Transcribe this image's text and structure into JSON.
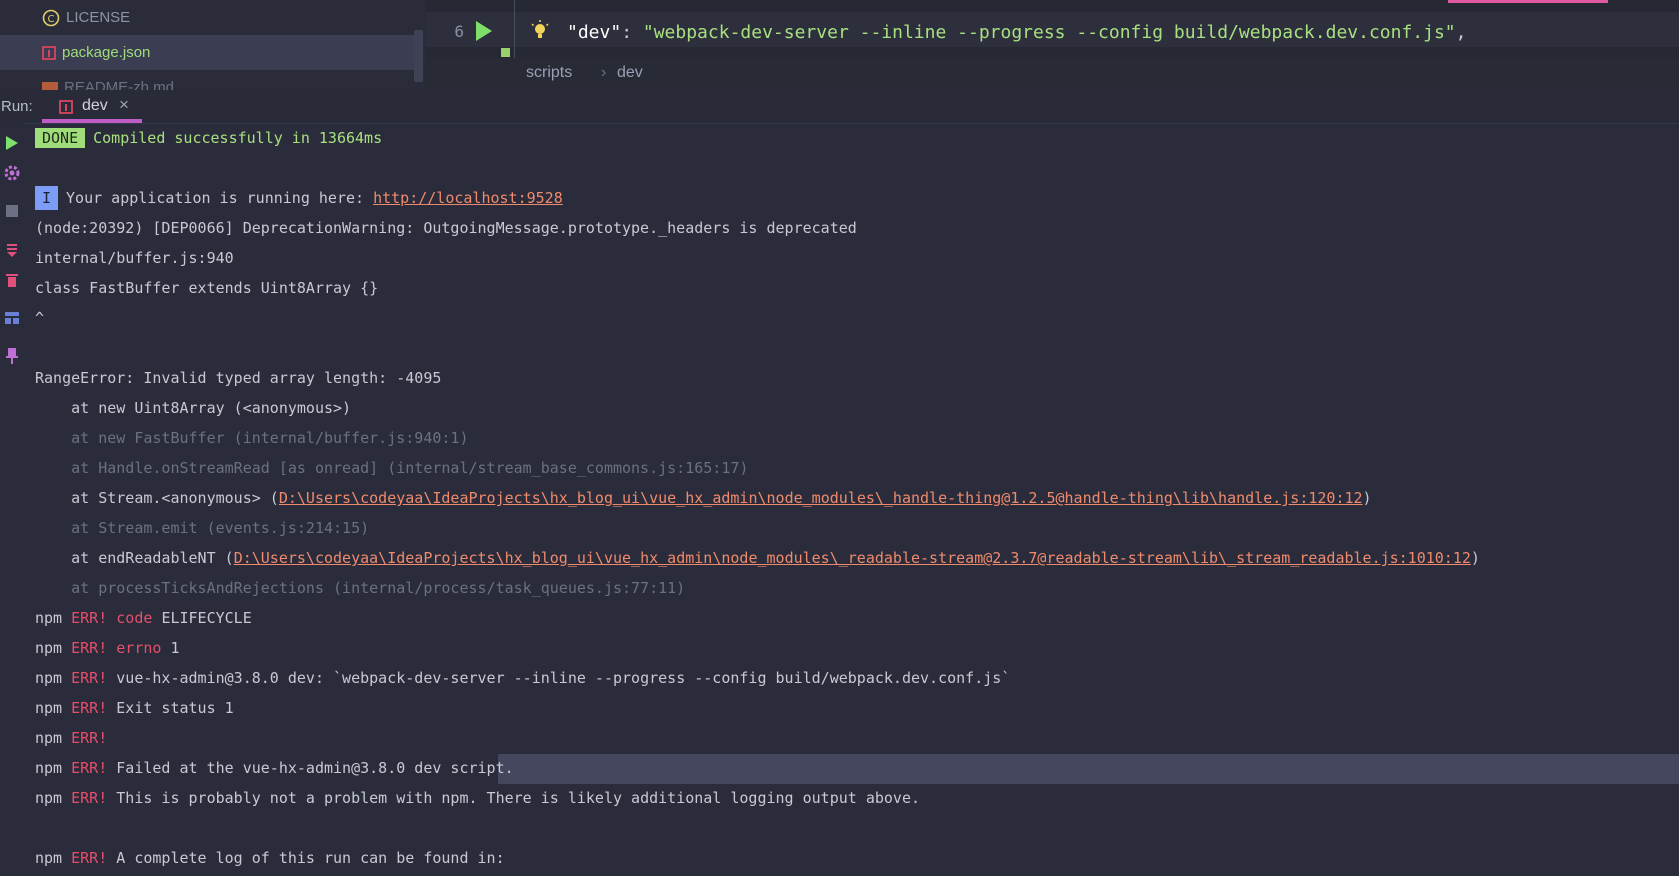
{
  "project": {
    "items": [
      {
        "label": "LICENSE",
        "icon": "license-icon",
        "selected": false
      },
      {
        "label": "package.json",
        "icon": "npm-file-icon",
        "selected": true
      },
      {
        "label": "README-zh.md",
        "icon": "markdown-file-icon",
        "selected": false
      }
    ]
  },
  "editor": {
    "line_number": "6",
    "code_key": "\"dev\"",
    "code_colon": ": ",
    "code_value": "\"webpack-dev-server --inline --progress --config build/webpack.dev.conf.js\"",
    "code_comma": ","
  },
  "breadcrumb": {
    "items": [
      "scripts",
      "dev"
    ],
    "separator": "›"
  },
  "run": {
    "label": "Run:",
    "tab_label": "dev",
    "tab_close": "×"
  },
  "console": {
    "done_badge": "DONE",
    "compiled": "Compiled successfully in 13664ms",
    "info_badge": "I",
    "running_prefix": "Your application is running here: ",
    "running_url": "http://localhost:9528",
    "deprecation": "(node:20392) [DEP0066] DeprecationWarning: OutgoingMessage.prototype._headers is deprecated",
    "buffer": "internal/buffer.js:940",
    "class_line": "class FastBuffer extends Uint8Array {}",
    "caret": "^",
    "range_error": "RangeError: Invalid typed array length: -4095",
    "stack1": "    at new Uint8Array (<anonymous>)",
    "stack2": "    at new FastBuffer (internal/buffer.js:940:1)",
    "stack3": "    at Handle.onStreamRead [as onread] (internal/stream_base_commons.js:165:17)",
    "stack4_prefix": "    at Stream.<anonymous> (",
    "stack4_link": "D:\\Users\\codeyaa\\IdeaProjects\\hx_blog_ui\\vue_hx_admin\\node_modules\\_handle-thing@1.2.5@handle-thing\\lib\\handle.js:120:12",
    "stack4_suffix": ")",
    "stack5": "    at Stream.emit (events.js:214:15)",
    "stack6_prefix": "    at endReadableNT (",
    "stack6_link": "D:\\Users\\codeyaa\\IdeaProjects\\hx_blog_ui\\vue_hx_admin\\node_modules\\_readable-stream@2.3.7@readable-stream\\lib\\_stream_readable.js:1010:12",
    "stack6_suffix": ")",
    "stack7": "    at processTicksAndRejections (internal/process/task_queues.js:77:11)",
    "npm": "npm",
    "err": "ERR!",
    "code_word": "code",
    "code_val": "ELIFECYCLE",
    "errno_word": "errno",
    "errno_val": "1",
    "script_line": "vue-hx-admin@3.8.0 dev: `webpack-dev-server --inline --progress --config build/webpack.dev.conf.js`",
    "exit": "Exit status 1",
    "failed": "Failed at the vue-hx-admin@3.8.0 dev script.",
    "probably": "This is probably not a problem with npm. There is likely additional logging output above.",
    "complete_log": "A complete log of this run can be found in:"
  },
  "colors": {
    "accent_green": "#a9e07f",
    "error_red": "#e54f6b",
    "link_orange": "#f08a6c",
    "tab_underline": "#c05cc8"
  }
}
